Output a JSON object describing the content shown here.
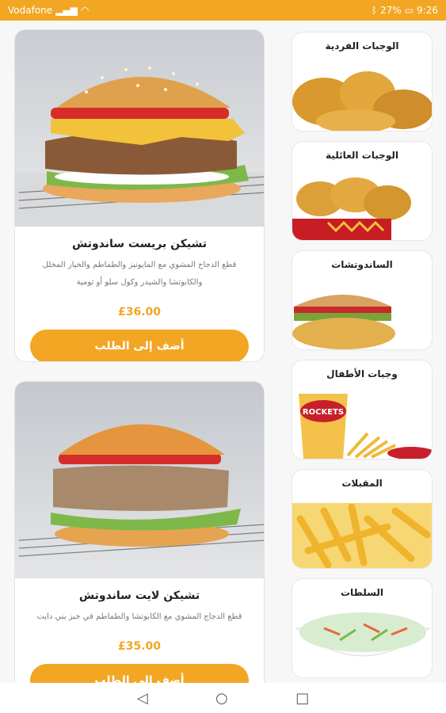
{
  "status": {
    "carrier": "Vodafone",
    "battery": "27%",
    "time": "9:26"
  },
  "categories": [
    {
      "title": "الوجبات الفردية",
      "icon": "fried-chicken-image"
    },
    {
      "title": "الوجبات العائلية",
      "icon": "chicken-bucket-image"
    },
    {
      "title": "الساندوتشات",
      "icon": "sandwich-image"
    },
    {
      "title": "وجبات الأطفال",
      "icon": "kids-meal-image"
    },
    {
      "title": "المقبلات",
      "icon": "fries-image"
    },
    {
      "title": "السلطات",
      "icon": "salad-image"
    }
  ],
  "products": [
    {
      "name": "تشيكن بريست ساندوتش",
      "description": "قطع الدجاج المشوي مع المايونيز والطماطم والخيار المخلل والكابوتشا والشيدر وكول سلو أو ثومية",
      "price": "£36.00",
      "button": "أضف إلى الطلب"
    },
    {
      "name": "تشيكن لايت ساندوتش",
      "description": "قطع الدجاج المشوي مع الكابوتشا والطماطم في خبز بني دايت",
      "price": "£35.00",
      "button": "أضف إلى الطلب"
    }
  ],
  "kids_logo_text": "ROCKETS",
  "colors": {
    "accent": "#f2a624"
  }
}
